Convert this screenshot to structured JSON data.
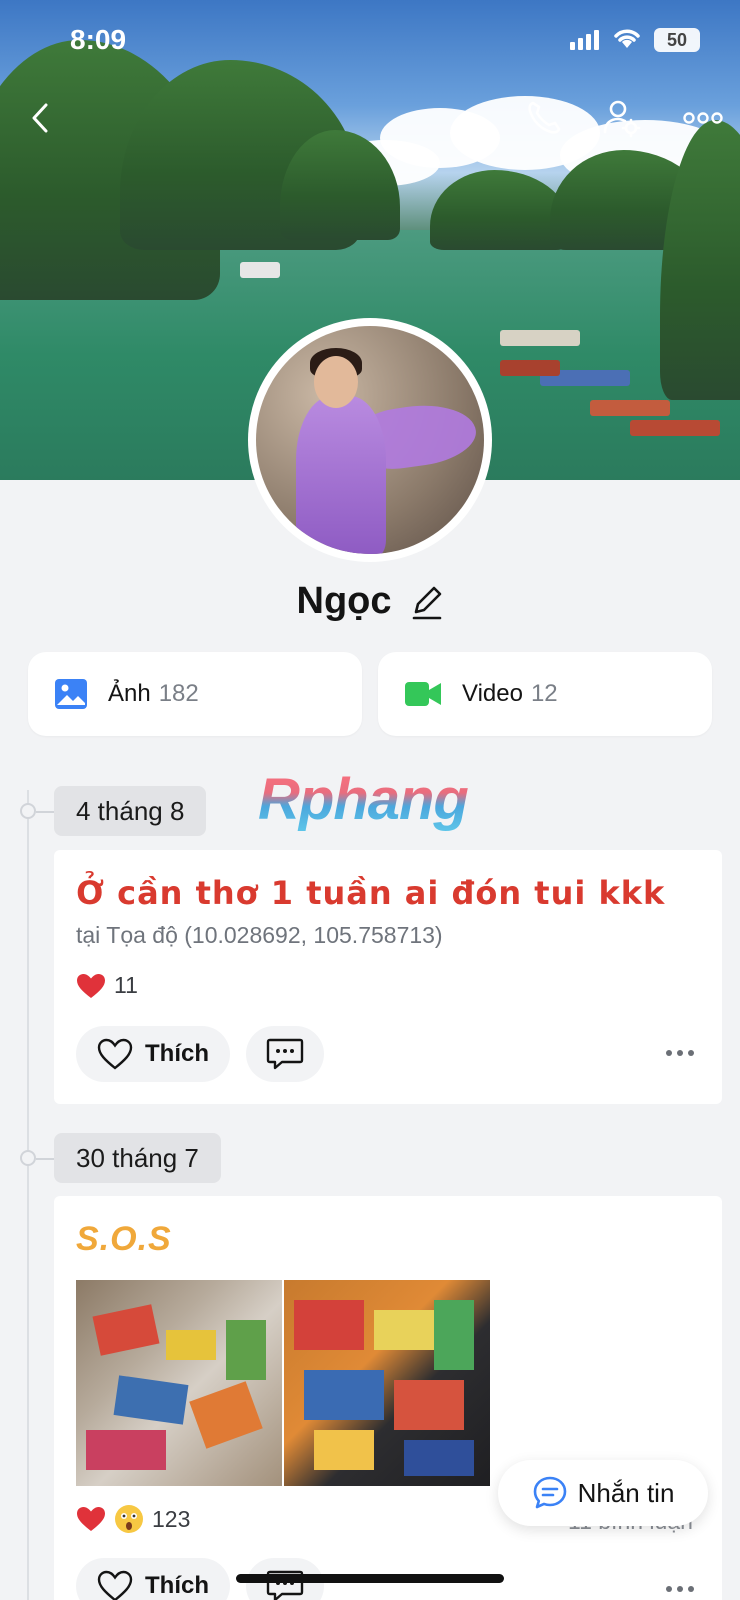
{
  "status_bar": {
    "time": "8:09",
    "battery": "50"
  },
  "profile": {
    "name": "Ngọc"
  },
  "media": [
    {
      "label": "Ảnh",
      "count": "182"
    },
    {
      "label": "Video",
      "count": "12"
    }
  ],
  "watermark": "Rphang",
  "posts": [
    {
      "date": "4 tháng 8",
      "title": "Ở cần thơ 1 tuần ai đón tui kkk",
      "location": "tại Tọa độ (10.028692, 105.758713)",
      "reaction_count": "11",
      "like_label": "Thích"
    },
    {
      "date": "30 tháng 7",
      "title": "S.O.S",
      "reaction_count": "123",
      "comments": "11 bình luận",
      "like_label": "Thích"
    }
  ],
  "message_button": "Nhắn tin",
  "colors": {
    "accent_blue": "#3b82f6",
    "video_green": "#34c759",
    "heart_red": "#e0323a",
    "title_red": "#d93a2f",
    "title_yellow": "#f0a83a"
  }
}
